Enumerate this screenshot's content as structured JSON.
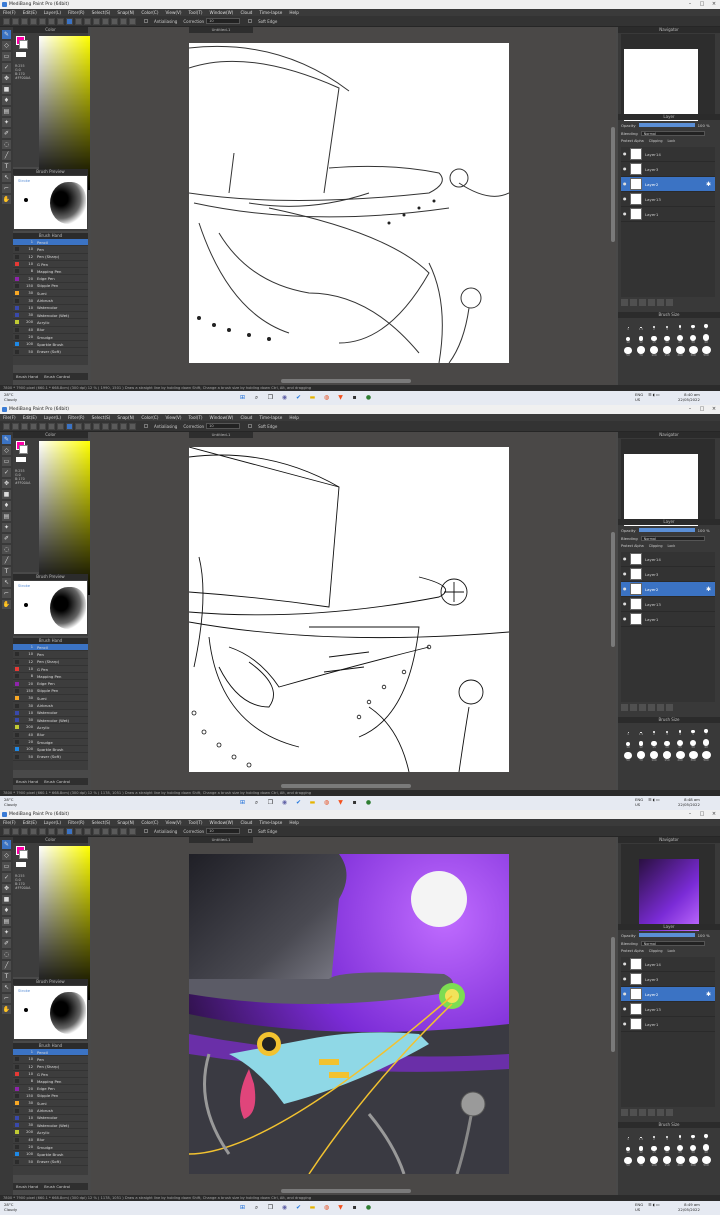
{
  "app": {
    "title": "MediBang Paint Pro (64bit)",
    "menu": [
      "File(F)",
      "Edit(E)",
      "Layer(L)",
      "Filter(R)",
      "Select(S)",
      "Snap(N)",
      "Color(C)",
      "View(V)",
      "Tool(T)",
      "Window(W)",
      "Cloud",
      "Time-lapse",
      "Help"
    ],
    "toolbar": {
      "antialias_label": "Antialiasing",
      "correction_label": "Correction",
      "correction_value": "10",
      "soft_edge_label": "Soft Edge"
    },
    "canvas_tab": "Untitled-1"
  },
  "color_panel": {
    "title": "Color",
    "r": "R:255",
    "g": "G:0",
    "b": "B:170",
    "hex": "#FF00AA",
    "fg": "#ff00aa",
    "bg": "#ffffff"
  },
  "brush_preview": {
    "title": "Brush Preview",
    "label": "Stroke"
  },
  "brush_list": {
    "title": "Brush Hand",
    "items": [
      {
        "size": "1",
        "name": "Pencil",
        "color": "#3b73c4"
      },
      {
        "size": "10",
        "name": "Pen",
        "color": "#2b2b2b"
      },
      {
        "size": "12",
        "name": "Pen (Sharp)",
        "color": "#2b2b2b"
      },
      {
        "size": "10",
        "name": "G Pen",
        "color": "#e53935"
      },
      {
        "size": "8",
        "name": "Mapping Pen",
        "color": "#2b2b2b"
      },
      {
        "size": "20",
        "name": "Edge Pen",
        "color": "#8e24aa"
      },
      {
        "size": "150",
        "name": "Stipple Pen",
        "color": "#2b2b2b"
      },
      {
        "size": "30",
        "name": "Sumi",
        "color": "#f9a825"
      },
      {
        "size": "30",
        "name": "Airbrush",
        "color": "#2b2b2b"
      },
      {
        "size": "10",
        "name": "Watercolor",
        "color": "#3949ab"
      },
      {
        "size": "30",
        "name": "Watercolor (Wet)",
        "color": "#3949ab"
      },
      {
        "size": "200",
        "name": "Acrylic",
        "color": "#c0ca33"
      },
      {
        "size": "40",
        "name": "Blur",
        "color": "#2b2b2b"
      },
      {
        "size": "20",
        "name": "Smudge",
        "color": "#2b2b2b"
      },
      {
        "size": "100",
        "name": "Sparkle Brush",
        "color": "#1e88e5"
      },
      {
        "size": "50",
        "name": "Eraser (Soft)",
        "color": "#2b2b2b"
      }
    ],
    "tabs": [
      "Brush Hand",
      "Brush Control"
    ]
  },
  "navigator": {
    "title": "Navigator"
  },
  "layer_panel": {
    "title": "Layer",
    "opacity_label": "Opacity",
    "opacity_value": "100 %",
    "blending_label": "Blending",
    "blending_value": "Normal",
    "protect_alpha": "Protect Alpha",
    "clipping": "Clipping",
    "lock": "Lock",
    "layers": [
      {
        "name": "Layer14",
        "selected": false
      },
      {
        "name": "Layer3",
        "selected": false
      },
      {
        "name": "Layer2",
        "selected": true
      },
      {
        "name": "Layer13",
        "selected": false
      },
      {
        "name": "Layer1",
        "selected": false
      }
    ]
  },
  "brush_size": {
    "title": "Brush Size",
    "sizes": [
      "1",
      "1.5",
      "2",
      "3",
      "4",
      "5",
      "7",
      "10",
      "12",
      "15",
      "20",
      "25",
      "30",
      "40",
      "50",
      "70",
      "100",
      "150",
      "200",
      "300",
      "500"
    ]
  },
  "status": [
    "7800 * 7900 pixel  (660.1 * 668.8cm)  (300 dpi)  12 %  ( 1990, 1501 )  Draw a straight line by holding down Shift, Change a brush size by holding down Ctrl, Alt, and dragging",
    "7800 * 7900 pixel  (660.1 * 668.8cm)  (300 dpi)  12 %  ( 1178, 1051 )  Draw a straight line by holding down Shift, Change a brush size by holding down Ctrl, Alt, and dragging",
    "7800 * 7900 pixel  (660.1 * 668.8cm)  (300 dpi)  12 %  ( 1178, 1051 )  Draw a straight line by holding down Shift, Change a brush size by holding down Ctrl, Alt, and dragging"
  ],
  "taskbar": {
    "weather_temp": "28°C",
    "weather_desc": "Cloudy",
    "lang": "ENG",
    "region": "US",
    "times": [
      "8:40 am",
      "8:48 am",
      "8:49 am"
    ],
    "date": "22/05/2022"
  },
  "art_colors": {
    "purple": "#7a2bd6",
    "hat": "#4a4a52",
    "beak": "#8fd8e6",
    "tongue": "#e0457b",
    "moon": "#f4f4f4",
    "gold": "#f2c230"
  }
}
